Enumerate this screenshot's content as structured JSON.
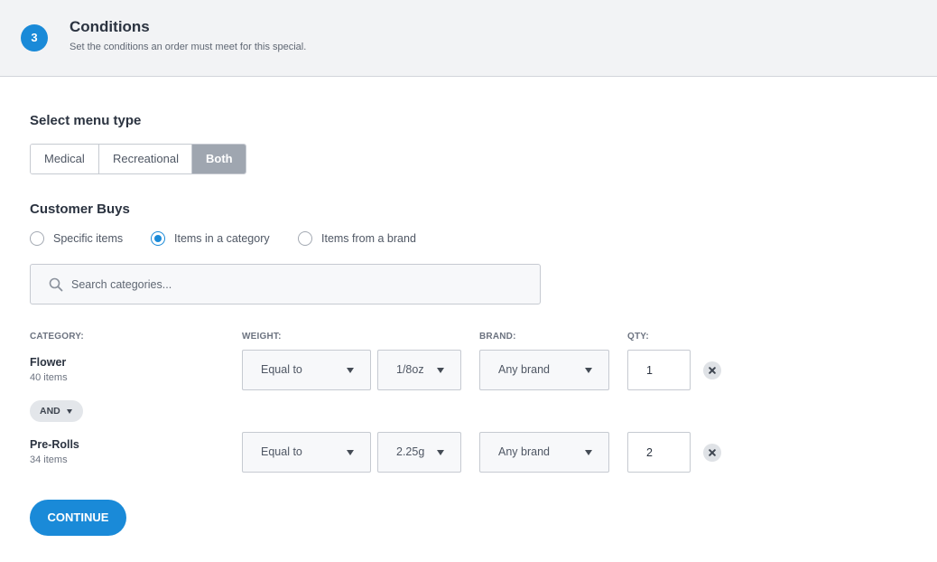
{
  "header": {
    "step_number": "3",
    "title": "Conditions",
    "subtitle": "Set the conditions an order must meet for this special."
  },
  "menu_type": {
    "title": "Select menu type",
    "options": [
      "Medical",
      "Recreational",
      "Both"
    ],
    "selected": "Both"
  },
  "customer_buys": {
    "title": "Customer Buys",
    "options": [
      "Specific items",
      "Items in a category",
      "Items from a brand"
    ],
    "selected": "Items in a category"
  },
  "search": {
    "placeholder": "Search categories..."
  },
  "columns": {
    "category": "CATEGORY:",
    "weight": "WEIGHT:",
    "brand": "BRAND:",
    "qty": "QTY:"
  },
  "rows": [
    {
      "category": "Flower",
      "count": "40 items",
      "weight_operator": "Equal to",
      "weight_value": "1/8oz",
      "brand": "Any brand",
      "qty": "1"
    },
    {
      "category": "Pre-Rolls",
      "count": "34 items",
      "weight_operator": "Equal to",
      "weight_value": "2.25g",
      "brand": "Any brand",
      "qty": "2"
    }
  ],
  "conjunction": "AND",
  "continue_label": "CONTINUE",
  "colors": {
    "accent": "#1a8ad8",
    "selected_segment": "#9fa6b0",
    "header_bg": "#f2f3f5"
  }
}
